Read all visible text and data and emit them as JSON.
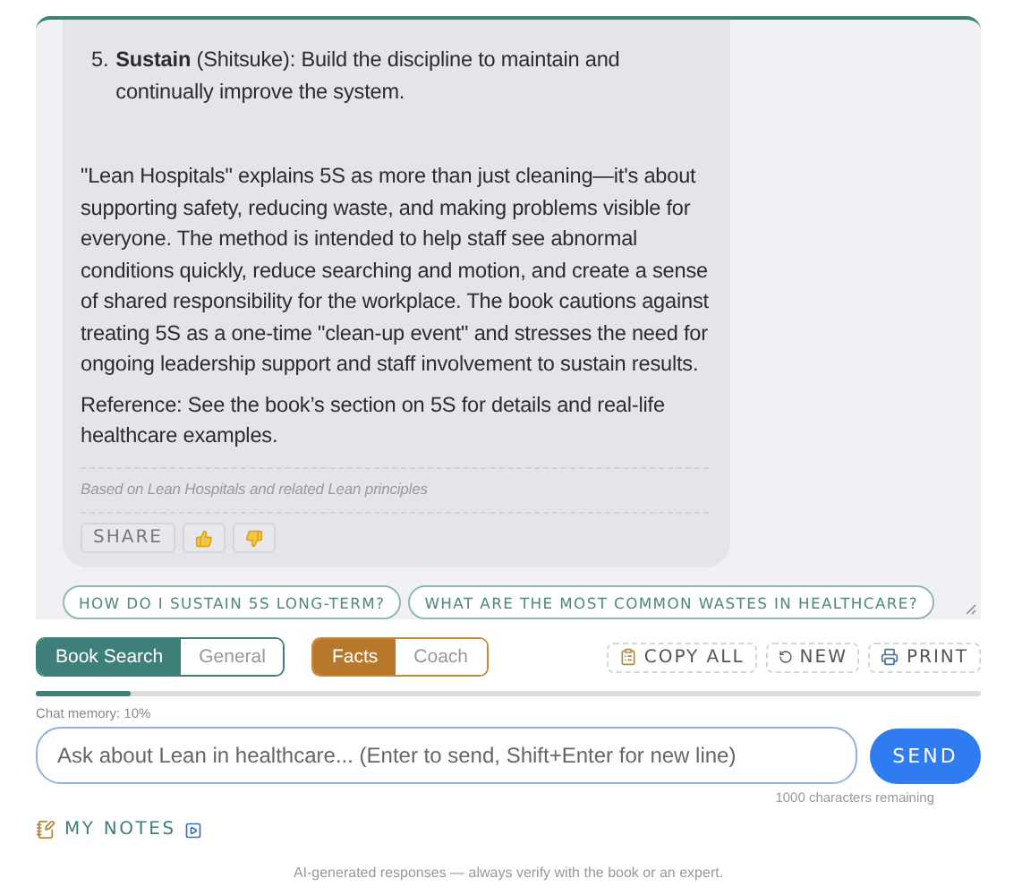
{
  "chat": {
    "message": {
      "list_item": {
        "number": "5.",
        "text": "**Sustain** (Shitsuke): Build the discipline to maintain and continually improve the system."
      },
      "paragraphs": [
        "\"Lean Hospitals\" explains 5S as more than just cleaning—it's about supporting safety, reducing waste, and making problems visible for everyone. The method is intended to help staff see abnormal conditions quickly, reduce searching and motion, and create a sense of shared responsibility for the workplace. The book cautions against treating 5S as a one-time \"clean-up event\" and stresses the need for ongoing leadership support and staff involvement to sustain results.",
        "Reference: See the book’s section on 5S for details and real-life healthcare examples."
      ],
      "source": "Based on Lean Hospitals and related Lean principles",
      "actions": [
        {
          "kind": "text",
          "label": "SHARE"
        },
        {
          "kind": "thumbs-up"
        },
        {
          "kind": "thumbs-down"
        }
      ]
    },
    "suggestions": [
      "HOW DO I SUSTAIN 5S LONG-TERM?",
      "WHAT ARE THE MOST COMMON WASTES IN HEALTHCARE?"
    ]
  },
  "mode_toggle": [
    {
      "label": "Book Search",
      "selected": true
    },
    {
      "label": "General",
      "selected": false
    }
  ],
  "style_toggle": [
    {
      "label": "Facts",
      "selected": true
    },
    {
      "label": "Coach",
      "selected": false
    }
  ],
  "actions": [
    {
      "kind": "copy",
      "label": "COPY ALL"
    },
    {
      "kind": "new",
      "label": "NEW"
    },
    {
      "kind": "print",
      "label": "PRINT"
    }
  ],
  "memory": {
    "label": "Chat memory: 10%",
    "level": 0.1
  },
  "input": {
    "placeholder": "Ask about Lean in healthcare... (Enter to send, Shift+Enter for new line)"
  },
  "send": "SEND",
  "chars_remaining": "1000 characters remaining",
  "notes": {
    "label": "MY NOTES"
  },
  "footer": "AI-generated responses — always verify with the book or an expert."
}
